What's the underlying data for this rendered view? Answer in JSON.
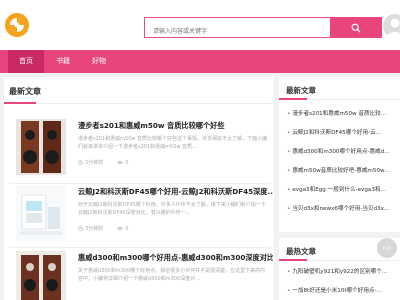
{
  "search": {
    "placeholder": "请输入内容或关键字"
  },
  "nav": {
    "items": [
      "首页",
      "书籍",
      "好物"
    ]
  },
  "main": {
    "section_title": "最新文章",
    "articles": [
      {
        "title": "漫步者s201和惠威m50w 音质比较哪个好些",
        "desc": "漫步者s201和惠威m50w 音质比较哪个好些这个事情，许多朋友不太了解，下面小编们就来讲讲介绍一下漫步者s201和惠威m50w 音质...",
        "time": "2分钟前",
        "views": "0"
      },
      {
        "title": "云鲸J2和科沃斯DF45哪个好用-云鲸J2和科沃斯DF45深度...",
        "desc": "对于云鲸J2和科沃斯DF45哪个好用，许多人伙伴不太了解，接下来小编们就介绍一下云鲸J2和科沃斯DF45深度对比，有兴趣的伙伴一...",
        "time": "3分钟前",
        "views": "0"
      },
      {
        "title": "惠威d300和m300哪个好用点-惠威d300和m300深度对比",
        "desc": "关于惠威d300和m300哪个好用点，相信很多小伙伴并不是很清楚，在这里下来的内容中，小编将详细介绍一下惠威d300和m300深度对...",
        "time": "",
        "views": ""
      }
    ]
  },
  "sidebar": {
    "latest_title": "最新文章",
    "latest_items": [
      "漫步者s201和惠威m50w 音质比较...",
      "云鲸J2和科沃斯DF45哪个好用-云...",
      "惠威d300和m300哪个好用点-惠威d...",
      "惠威m50w音质比较好吧-惠威m50w...",
      "evga3和Egg 一般到什么-evga3和...",
      "当贝d3x和newx6哪个好用-当贝d3x..."
    ],
    "hot_title": "最热文章",
    "hot_items": [
      "九阳破壁机y921和y922的区别哪个...",
      "一加8t好还是小米10t哪个好用点-..."
    ]
  },
  "back_to_top": "TOP",
  "colors": {
    "accent": "#e8457f",
    "nav_active": "#c92a63"
  },
  "icons": [
    "logo-icon",
    "search-icon",
    "user-icon",
    "clock-icon",
    "eye-icon"
  ]
}
